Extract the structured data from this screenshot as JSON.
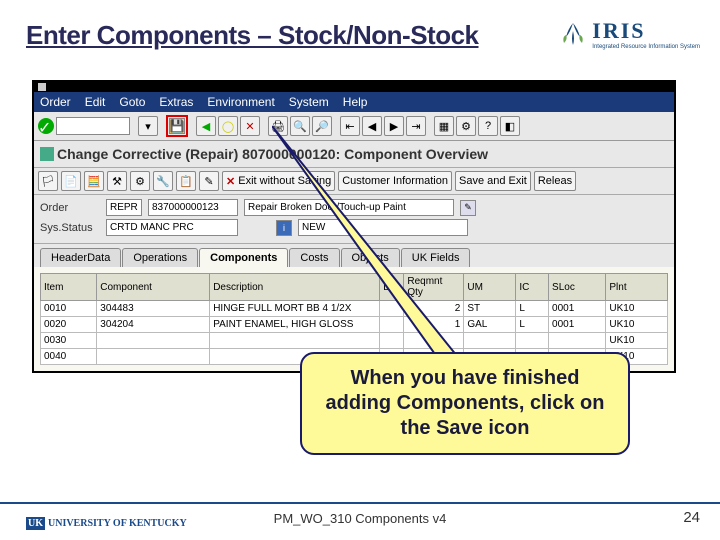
{
  "slide": {
    "title": "Enter Components – Stock/Non-Stock",
    "footer": "PM_WO_310 Components v4",
    "page": "24"
  },
  "callout": {
    "text": "When you have finished adding Components, click on the Save icon"
  },
  "menubar": [
    "Order",
    "Edit",
    "Goto",
    "Extras",
    "Environment",
    "System",
    "Help"
  ],
  "screen_title": "Change Corrective (Repair) 807000000120: Component Overview",
  "action_bar": {
    "exit": "Exit without Saving",
    "cust": "Customer Information",
    "save_exit": "Save and Exit",
    "release": "Releas"
  },
  "fields": {
    "order_label": "Order",
    "order_type": "REPR",
    "order_num": "837000000123",
    "order_desc": "Repair Broken Door/Touch-up Paint",
    "status_label": "Sys.Status",
    "status_val": "CRTD MANC PRC",
    "status2": "NEW"
  },
  "tabs": [
    "HeaderData",
    "Operations",
    "Components",
    "Costs",
    "Objects",
    "UK Fields"
  ],
  "table": {
    "headers": [
      "Item",
      "Component",
      "Description",
      "L",
      "Reqmnt Qty",
      "UM",
      "IC",
      "SLoc",
      "Plnt"
    ],
    "rows": [
      {
        "item": "0010",
        "comp": "304483",
        "desc": "HINGE FULL MORT BB 4 1/2X",
        "l": "",
        "qty": "2",
        "um": "ST",
        "ic": "L",
        "sloc": "0001",
        "plnt": "UK10"
      },
      {
        "item": "0020",
        "comp": "304204",
        "desc": "PAINT ENAMEL, HIGH GLOSS",
        "l": "",
        "qty": "1",
        "um": "GAL",
        "ic": "L",
        "sloc": "0001",
        "plnt": "UK10"
      },
      {
        "item": "0030",
        "comp": "",
        "desc": "",
        "l": "",
        "qty": "",
        "um": "",
        "ic": "",
        "sloc": "",
        "plnt": "UK10"
      },
      {
        "item": "0040",
        "comp": "",
        "desc": "",
        "l": "",
        "qty": "",
        "um": "",
        "ic": "",
        "sloc": "",
        "plnt": "UK10"
      }
    ]
  },
  "logo": {
    "iris": "IRIS",
    "tag": "Integrated Resource Information System",
    "uk": "UNIVERSITY OF KENTUCKY"
  }
}
